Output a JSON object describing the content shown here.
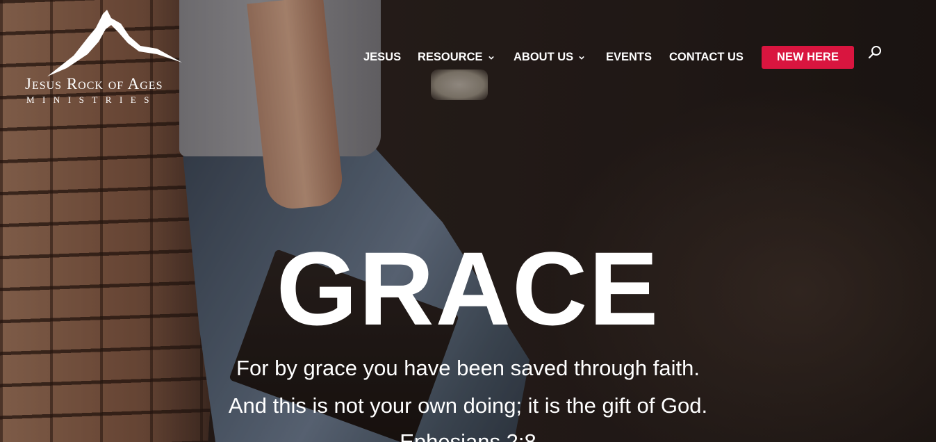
{
  "logo": {
    "name": "Jesus Rock of Ages",
    "subtitle": "MINISTRIES"
  },
  "nav": {
    "items": [
      {
        "label": "JESUS",
        "has_dropdown": false
      },
      {
        "label": "RESOURCE",
        "has_dropdown": true
      },
      {
        "label": "ABOUT US",
        "has_dropdown": true
      },
      {
        "label": "EVENTS",
        "has_dropdown": false
      },
      {
        "label": "CONTACT US",
        "has_dropdown": false
      }
    ],
    "cta_label": "NEW HERE",
    "search_icon": "search-icon"
  },
  "hero": {
    "title": "GRACE",
    "verse_line1": "For by grace you have been saved through faith.",
    "verse_line2": "And this is not your own doing; it is the gift of God.",
    "reference": "Ephesians 2:8"
  },
  "colors": {
    "accent": "#d9153f",
    "text": "#ffffff"
  }
}
